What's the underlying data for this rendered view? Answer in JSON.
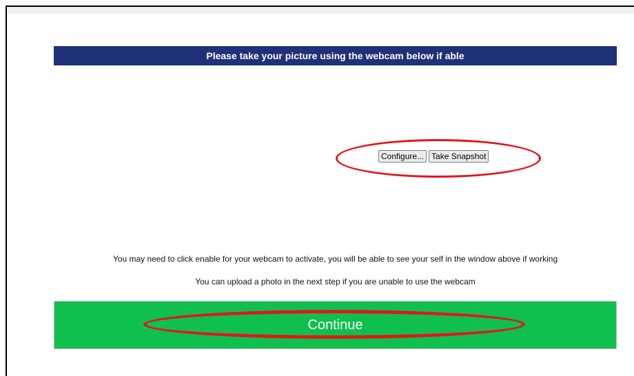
{
  "header": {
    "title": "Please take your picture using the webcam below if able"
  },
  "webcam": {
    "configure_label": "Configure...",
    "snapshot_label": "Take Snapshot"
  },
  "info": {
    "line1": "You may need to click enable for your webcam to activate, you will be able to see your self in the window above if working",
    "line2": "You can upload a photo in the next step if you are unable to use the webcam"
  },
  "continue": {
    "label": "Continue"
  },
  "colors": {
    "header_bg": "#1f3178",
    "continue_bg": "#0fc04e",
    "annotation_red": "#e3161b"
  }
}
